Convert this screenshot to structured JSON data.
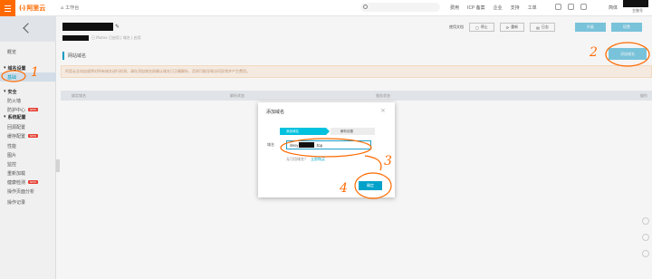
{
  "topbar": {
    "brand": "阿里云",
    "workbench": "工作台",
    "nav": [
      "费用",
      "ICP 备案",
      "企业",
      "支持",
      "工单"
    ],
    "lang": "简体",
    "account_sub": "主账号"
  },
  "sidebar": {
    "items": [
      {
        "label": "概览",
        "type": "item"
      },
      {
        "label": "域名设置",
        "type": "group"
      },
      {
        "label": "基础",
        "type": "item",
        "active": true
      },
      {
        "label": "安全",
        "type": "group"
      },
      {
        "label": "防火墙",
        "type": "item"
      },
      {
        "label": "防护中心",
        "type": "item",
        "badge": "NEW"
      },
      {
        "label": "系统配置",
        "type": "group"
      },
      {
        "label": "回源配置",
        "type": "item"
      },
      {
        "label": "缓存配置",
        "type": "item",
        "badge": "NEW"
      },
      {
        "label": "性能",
        "type": "item"
      },
      {
        "label": "图片",
        "type": "item"
      },
      {
        "label": "监控",
        "type": "item"
      },
      {
        "label": "重新加载",
        "type": "item"
      },
      {
        "label": "健康检测",
        "type": "item",
        "badge": "NEW"
      },
      {
        "label": "操作页面分析",
        "type": "item"
      },
      {
        "label": "操作记录",
        "type": "item"
      }
    ]
  },
  "header": {
    "subline": "已 Mutex 已启用 | 域名 | 启用",
    "doc_link": "使用文档",
    "buttons": [
      "停止",
      "重新",
      "日志",
      "删除"
    ],
    "primary_buttons": [
      "升级",
      "续费"
    ]
  },
  "section": {
    "title": "网站域名",
    "add_button": "添加域名"
  },
  "notice": "阿里云全站加速将对所有域名进行检测，请在添加域名前确认域名已正确解析，否则可能导致访问异常并产生费用。",
  "table": {
    "columns": [
      "绑定域名",
      "解析状态",
      "服务状态",
      "操作"
    ]
  },
  "modal": {
    "title": "添加域名",
    "close": "×",
    "steps": [
      "添加域名",
      "解析设置"
    ],
    "field_label": "域名",
    "input_prefix": "desy",
    "input_suffix": ".top",
    "help_question": "无可用域名？",
    "help_link": "立即购买",
    "confirm": "确定"
  },
  "annotations": [
    "1",
    "2",
    "3",
    "4"
  ],
  "colors": {
    "brand": "#ff6a00",
    "accent": "#00a2ca",
    "step_active": "#00c1de",
    "annotation": "#ff6a00"
  }
}
